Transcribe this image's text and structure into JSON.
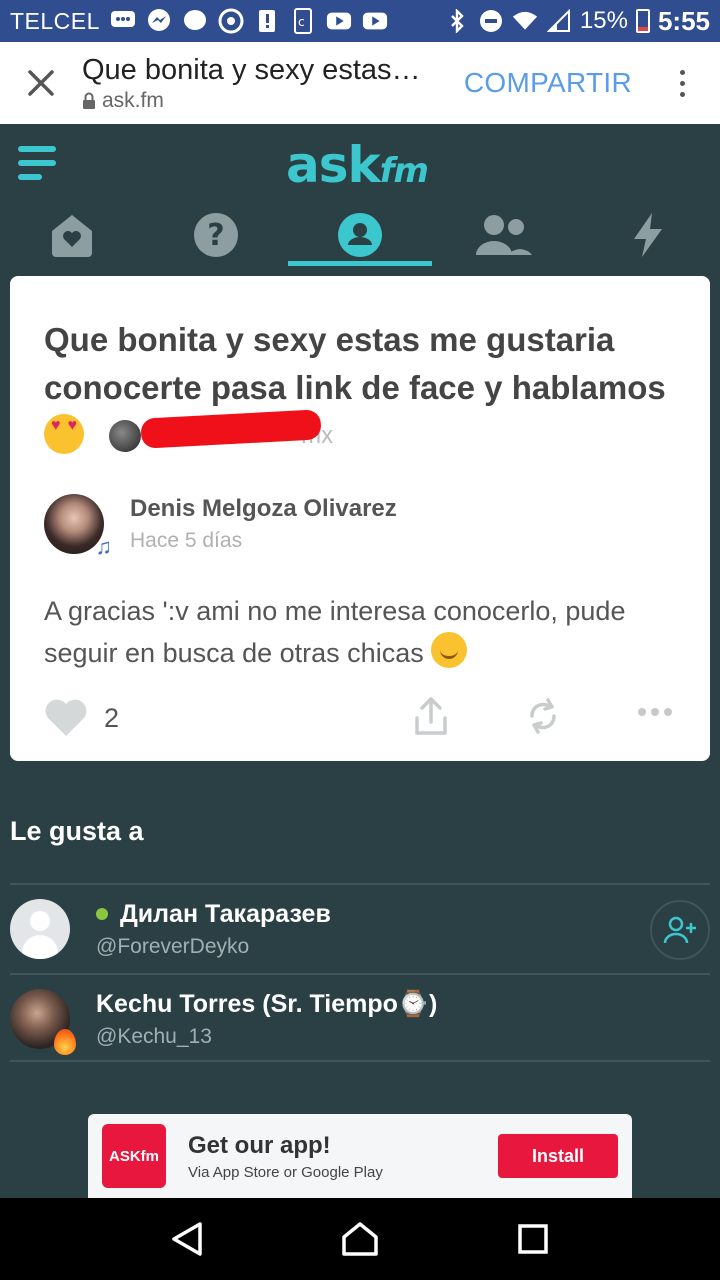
{
  "status_bar": {
    "carrier": "TELCEL",
    "battery": "15%",
    "time": "5:55"
  },
  "browser": {
    "title": "Que bonita y sexy estas…",
    "url": "ask.fm",
    "share_label": "COMPARTIR"
  },
  "app": {
    "logo_main": "ask",
    "logo_suffix": "fm",
    "accent": "#3cc7cf",
    "tabs": [
      {
        "icon": "home-icon",
        "active": false
      },
      {
        "icon": "question-icon",
        "active": false
      },
      {
        "icon": "profile-icon",
        "active": true
      },
      {
        "icon": "friends-icon",
        "active": false
      },
      {
        "icon": "lightning-icon",
        "active": false
      }
    ]
  },
  "post": {
    "question": "Que bonita y sexy estas me gustaria conocerte pasa link de face y hablamos",
    "asker_visible_suffix": "mx",
    "answerer_name": "Denis Melgoza Olivarez",
    "answer_time": "Hace 5 días",
    "answer": "A gracias ':v ami no me interesa conocerlo, pude seguir en busca de otras chicas",
    "like_count": "2"
  },
  "likes": {
    "title": "Le gusta a",
    "users": [
      {
        "name": "Дилан Такаразев",
        "handle": "@ForeverDeyko",
        "online": true
      },
      {
        "name": "Kechu Torres (Sr. Tiempo⌚)",
        "handle": "@Kechu_13",
        "online": false
      }
    ]
  },
  "banner": {
    "logo": "ASKfm",
    "title": "Get our app!",
    "subtitle": "Via App Store or Google Play",
    "install_label": "Install"
  }
}
